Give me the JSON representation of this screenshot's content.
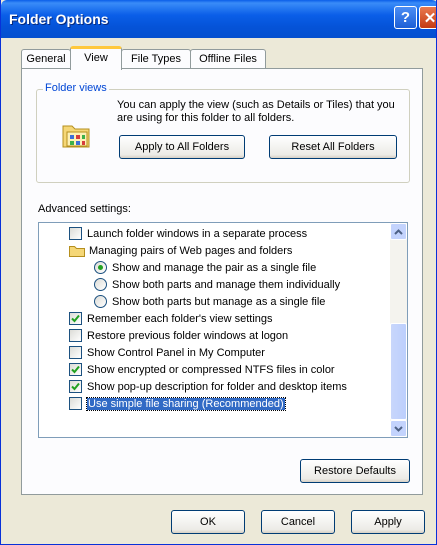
{
  "window": {
    "title": "Folder Options"
  },
  "tabs": [
    {
      "label": "General"
    },
    {
      "label": "View"
    },
    {
      "label": "File Types"
    },
    {
      "label": "Offline Files"
    }
  ],
  "folder_views": {
    "title": "Folder views",
    "description": "You can apply the view (such as Details or Tiles) that you are using for this folder to all folders.",
    "apply_all": "Apply to All Folders",
    "reset_all": "Reset All Folders"
  },
  "advanced": {
    "label": "Advanced settings:",
    "items": [
      {
        "text": "Launch folder windows in a separate process",
        "kind": "checkbox",
        "checked": false
      },
      {
        "text": "Managing pairs of Web pages and folders",
        "kind": "folder",
        "checked": false
      },
      {
        "text": "Show and manage the pair as a single file",
        "kind": "radio",
        "checked": true
      },
      {
        "text": "Show both parts and manage them individually",
        "kind": "radio",
        "checked": false
      },
      {
        "text": "Show both parts but manage as a single file",
        "kind": "radio",
        "checked": false
      },
      {
        "text": "Remember each folder's view settings",
        "kind": "checkbox",
        "checked": true
      },
      {
        "text": "Restore previous folder windows at logon",
        "kind": "checkbox",
        "checked": false
      },
      {
        "text": "Show Control Panel in My Computer",
        "kind": "checkbox",
        "checked": false
      },
      {
        "text": "Show encrypted or compressed NTFS files in color",
        "kind": "checkbox",
        "checked": true
      },
      {
        "text": "Show pop-up description for folder and desktop items",
        "kind": "checkbox",
        "checked": true
      },
      {
        "text": "Use simple file sharing (Recommended)",
        "kind": "checkbox",
        "checked": false,
        "selected": true
      }
    ],
    "restore_defaults": "Restore Defaults"
  },
  "footer": {
    "ok": "OK",
    "cancel": "Cancel",
    "apply": "Apply"
  },
  "colors": {
    "title_bar": "#0a5ee8",
    "dialog_bg": "#ece9d8",
    "selection": "#316ac5",
    "check": "#21a121"
  }
}
